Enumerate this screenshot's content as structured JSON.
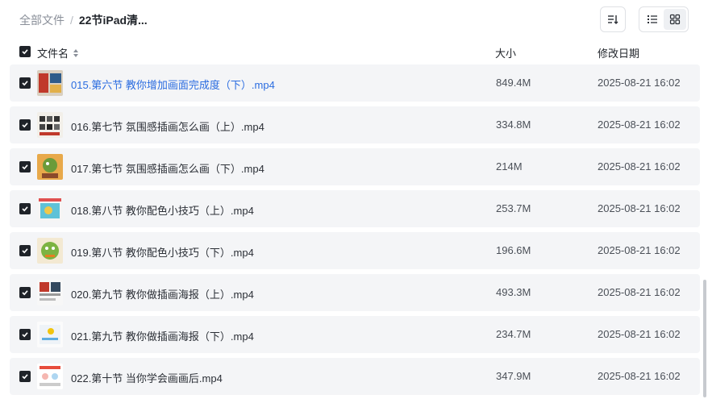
{
  "breadcrumb": {
    "root": "全部文件",
    "separator": "/",
    "current": "22节iPad清..."
  },
  "columns": {
    "name": "文件名",
    "size": "大小",
    "date": "修改日期"
  },
  "files": [
    {
      "name": "015.第六节 教你增加画面完成度（下）.mp4",
      "size": "849.4M",
      "date": "2025-08-21 16:02",
      "highlight": true
    },
    {
      "name": "016.第七节 氛围感插画怎么画（上）.mp4",
      "size": "334.8M",
      "date": "2025-08-21 16:02",
      "highlight": false
    },
    {
      "name": "017.第七节 氛围感插画怎么画（下）.mp4",
      "size": "214M",
      "date": "2025-08-21 16:02",
      "highlight": false
    },
    {
      "name": "018.第八节 教你配色小技巧（上）.mp4",
      "size": "253.7M",
      "date": "2025-08-21 16:02",
      "highlight": false
    },
    {
      "name": "019.第八节 教你配色小技巧（下）.mp4",
      "size": "196.6M",
      "date": "2025-08-21 16:02",
      "highlight": false
    },
    {
      "name": "020.第九节 教你做插画海报（上）.mp4",
      "size": "493.3M",
      "date": "2025-08-21 16:02",
      "highlight": false
    },
    {
      "name": "021.第九节 教你做插画海报（下）.mp4",
      "size": "234.7M",
      "date": "2025-08-21 16:02",
      "highlight": false
    },
    {
      "name": "022.第十节 当你学会画画后.mp4",
      "size": "347.9M",
      "date": "2025-08-21 16:02",
      "highlight": false
    }
  ],
  "colors": {
    "link": "#2a6ce0",
    "row_bg": "#f4f5f7",
    "checkbox": "#1f2329"
  },
  "icons": {
    "sort": "sort-icon",
    "list_view": "list-view-icon",
    "grid_view": "grid-view-icon",
    "sort_toggle": "sort-toggle-icon",
    "check": "check-icon"
  }
}
